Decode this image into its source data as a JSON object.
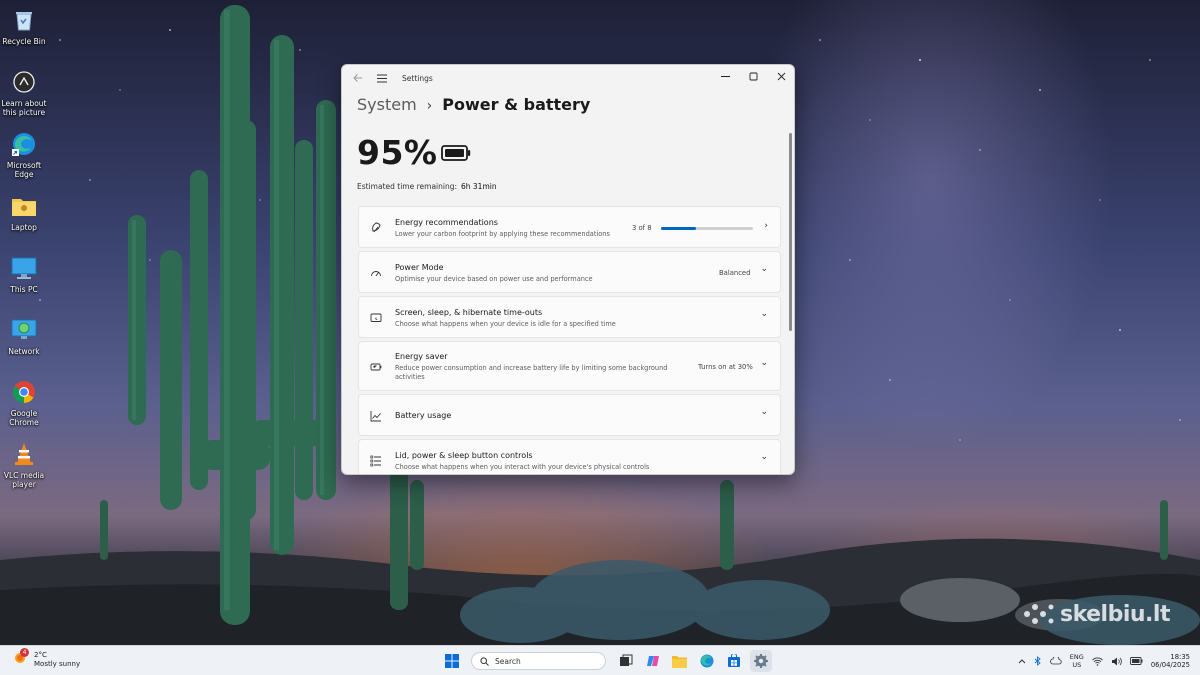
{
  "desktop": {
    "icons": [
      {
        "label": "Recycle Bin"
      },
      {
        "label": "Learn about this picture"
      },
      {
        "label": "Microsoft Edge"
      },
      {
        "label": "Laptop"
      },
      {
        "label": "This PC"
      },
      {
        "label": "Network"
      },
      {
        "label": "Google Chrome"
      },
      {
        "label": "VLC media player"
      }
    ],
    "watermark": "skelbiu.lt"
  },
  "window": {
    "title": "Settings",
    "breadcrumb_parent": "System",
    "breadcrumb_current": "Power & battery",
    "battery_percent": "95%",
    "estimated_label": "Estimated time remaining:",
    "estimated_value": "6h 31min",
    "cards": [
      {
        "title": "Energy recommendations",
        "subtitle": "Lower your carbon footprint by applying these recommendations",
        "value": "3 of 8",
        "progress": 0.375,
        "icon": "leaf-icon",
        "chevron": "›"
      },
      {
        "title": "Power Mode",
        "subtitle": "Optimise your device based on power use and performance",
        "value": "Balanced",
        "icon": "gauge-icon",
        "chevron": "⌄"
      },
      {
        "title": "Screen, sleep, & hibernate time-outs",
        "subtitle": "Choose what happens when your device is idle for a specified time",
        "value": "",
        "icon": "screen-sleep-icon",
        "chevron": "⌄"
      },
      {
        "title": "Energy saver",
        "subtitle": "Reduce power consumption and increase battery life by limiting some background activities",
        "value": "Turns on at 30%",
        "icon": "energy-saver-icon",
        "chevron": "⌄"
      },
      {
        "title": "Battery usage",
        "subtitle": "",
        "value": "",
        "icon": "chart-line-icon",
        "chevron": "⌄"
      },
      {
        "title": "Lid, power & sleep button controls",
        "subtitle": "Choose what happens when you interact with your device's physical controls",
        "value": "",
        "icon": "list-settings-icon",
        "chevron": "⌄"
      }
    ]
  },
  "taskbar": {
    "weather_temp": "2°C",
    "weather_desc": "Mostly sunny",
    "weather_badge": "4",
    "search_placeholder": "Search",
    "lang_top": "ENG",
    "lang_bottom": "US",
    "time": "18:35",
    "date": "06/04/2025"
  },
  "colors": {
    "accent": "#0067c0",
    "window_bg": "#f3f3f3",
    "card_bg": "#fbfbfb",
    "taskbar_bg": "#eef1f6"
  }
}
